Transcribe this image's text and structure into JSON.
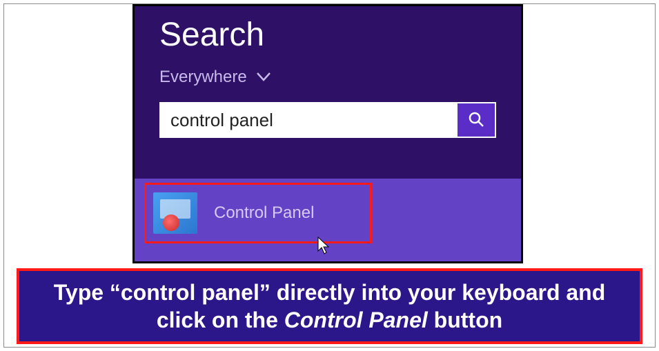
{
  "search_panel": {
    "title": "Search",
    "scope_label": "Everywhere",
    "search_value": "control panel",
    "search_placeholder": "",
    "result": {
      "icon_name": "control-panel-icon",
      "label": "Control Panel"
    }
  },
  "caption": {
    "pre": "Type “",
    "quoted": "control panel",
    "mid": "” directly into your keyboard and click on the ",
    "em": "Control Panel",
    "post": " button"
  },
  "colors": {
    "panel_bg": "#2e1067",
    "results_bg": "#6442c5",
    "caption_bg": "#2b168a",
    "highlight_border": "#ff1a1a",
    "accent": "#5a2dc7"
  }
}
